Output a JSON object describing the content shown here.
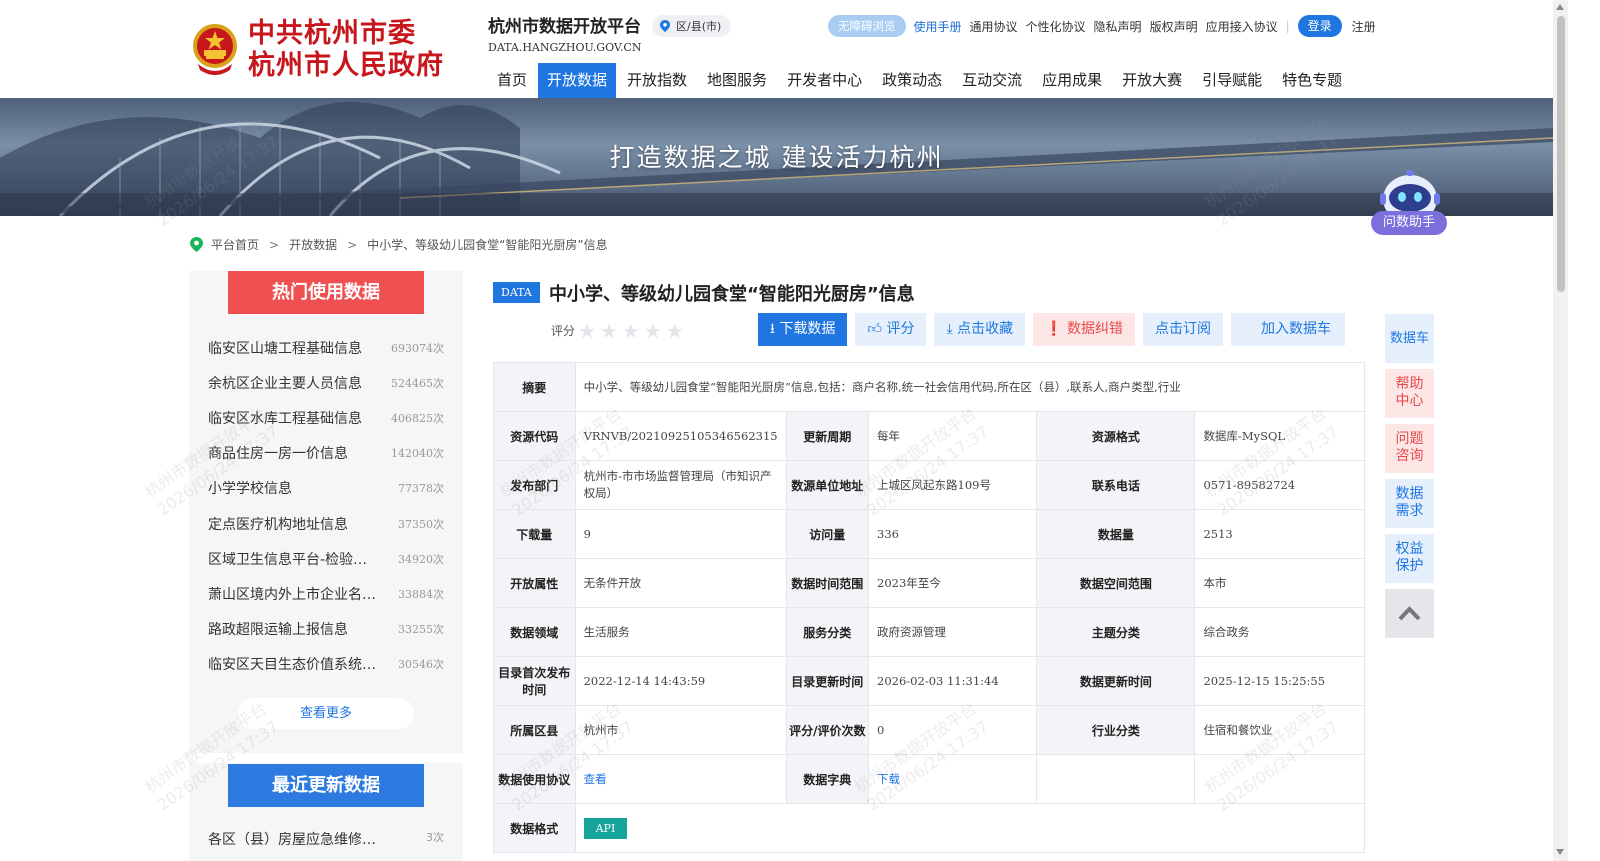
{
  "header": {
    "logo_line1": "中共杭州市委",
    "logo_line2": "杭州市人民政府",
    "site_title": "杭州市数据开放平台",
    "site_domain": "DATA.HANGZHOU.GOV.CN",
    "region_label": "区/县(市)",
    "accessibility_label": "无障碍浏览",
    "links": [
      "使用手册",
      "通用协议",
      "个性化协议",
      "隐私声明",
      "版权声明",
      "应用接入协议"
    ],
    "login_label": "登录",
    "register_label": "注册",
    "nav": [
      "首页",
      "开放数据",
      "开放指数",
      "地图服务",
      "开发者中心",
      "政策动态",
      "互动交流",
      "应用成果",
      "开放大赛",
      "引导赋能",
      "特色专题"
    ],
    "nav_active": "开放数据"
  },
  "banner": {
    "slogan": "打造数据之城   建设活力杭州",
    "assistant_label": "问数助手"
  },
  "breadcrumb": [
    "平台首页",
    "开放数据",
    "中小学、等级幼儿园食堂“智能阳光厨房”信息"
  ],
  "hot": {
    "title": "热门使用数据",
    "items": [
      {
        "name": "临安区山塘工程基础信息",
        "count": "693074次"
      },
      {
        "name": "余杭区企业主要人员信息",
        "count": "524465次"
      },
      {
        "name": "临安区水库工程基础信息",
        "count": "406825次"
      },
      {
        "name": "商品住房一房一价信息",
        "count": "142040次"
      },
      {
        "name": "小学学校信息",
        "count": "77378次"
      },
      {
        "name": "定点医疗机构地址信息",
        "count": "37350次"
      },
      {
        "name": "区域卫生信息平台-检验…",
        "count": "34920次"
      },
      {
        "name": "萧山区境内外上市企业名…",
        "count": "33884次"
      },
      {
        "name": "路政超限运输上报信息",
        "count": "33255次"
      },
      {
        "name": "临安区天目生态价值系统…",
        "count": "30546次"
      }
    ],
    "more_label": "查看更多"
  },
  "recent": {
    "title": "最近更新数据",
    "items": [
      {
        "name": "各区（县）房屋应急维修…",
        "count": "3次"
      }
    ]
  },
  "dataset": {
    "badge": "DATA",
    "title": "中小学、等级幼儿园食堂“智能阳光厨房”信息",
    "rating_label": "评分",
    "rating_value": 0,
    "actions": [
      "下载数据",
      "评分",
      "点击收藏",
      "数据纠错",
      "点击订阅",
      "加入数据车"
    ],
    "summary_label": "摘要",
    "summary": "中小学、等级幼儿园食堂“智能阳光厨房”信息,包括：商户名称,统一社会信用代码,所在区（县）,联系人,商户类型,行业",
    "rows": [
      [
        [
          "资源代码",
          "VRNVB/20210925105346562315"
        ],
        [
          "更新周期",
          "每年"
        ],
        [
          "资源格式",
          "数据库-MySQL"
        ]
      ],
      [
        [
          "发布部门",
          "杭州市-市市场监督管理局（市知识产权局）"
        ],
        [
          "数源单位地址",
          "上城区凤起东路109号"
        ],
        [
          "联系电话",
          "0571-89582724"
        ]
      ],
      [
        [
          "下载量",
          "9"
        ],
        [
          "访问量",
          "336"
        ],
        [
          "数据量",
          "2513"
        ]
      ],
      [
        [
          "开放属性",
          "无条件开放"
        ],
        [
          "数据时间范围",
          "2023年至今"
        ],
        [
          "数据空间范围",
          "本市"
        ]
      ],
      [
        [
          "数据领域",
          "生活服务"
        ],
        [
          "服务分类",
          "政府资源管理"
        ],
        [
          "主题分类",
          "综合政务"
        ]
      ],
      [
        [
          "目录首次发布时间",
          "2022-12-14 14:43:59"
        ],
        [
          "目录更新时间",
          "2026-02-03 11:31:44"
        ],
        [
          "数据更新时间",
          "2025-12-15 15:25:55"
        ]
      ],
      [
        [
          "所属区县",
          "杭州市"
        ],
        [
          "评分/评价次数",
          "0"
        ],
        [
          "行业分类",
          "住宿和餐饮业"
        ]
      ]
    ],
    "agreement_label": "数据使用协议",
    "agreement_link": "查看",
    "dictionary_label": "数据字典",
    "dictionary_link": "下载",
    "format_label": "数据格式",
    "format_tag": "API"
  },
  "side": {
    "cart": "数据车",
    "help": "帮助中心",
    "question": "问题咨询",
    "demand": "数据需求",
    "rights": "权益保护"
  },
  "watermark": {
    "line1": "杭州市数据开放平台",
    "line2": "2026/06/24 17:37"
  },
  "colors": {
    "primary": "#1f76e0",
    "hot_red": "#ef5050",
    "logo_red": "#c8161d",
    "api_teal": "#16a39a"
  }
}
